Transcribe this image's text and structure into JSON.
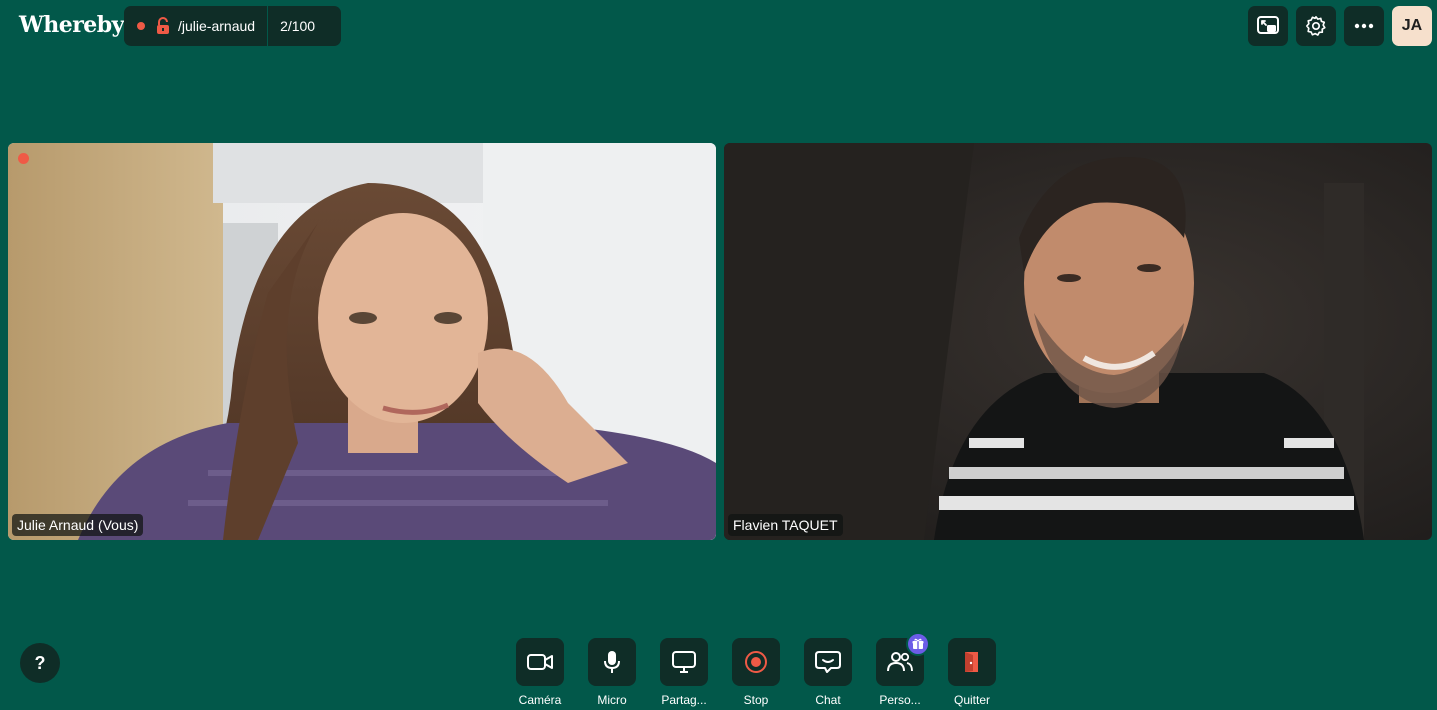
{
  "app": {
    "logo": "Whereby"
  },
  "room": {
    "name": "/julie-arnaud",
    "count": "2/100"
  },
  "header": {
    "avatar_initials": "JA",
    "icons": [
      "pip-icon",
      "gear-icon",
      "more-icon"
    ]
  },
  "participants": [
    {
      "name": "Julie Arnaud (Vous)",
      "recording": true
    },
    {
      "name": "Flavien TAQUET"
    }
  ],
  "controls": [
    {
      "label": "Caméra",
      "icon": "camera-icon"
    },
    {
      "label": "Micro",
      "icon": "microphone-icon"
    },
    {
      "label": "Partag...",
      "icon": "screen-share-icon"
    },
    {
      "label": "Stop",
      "icon": "record-stop-icon"
    },
    {
      "label": "Chat",
      "icon": "chat-icon"
    },
    {
      "label": "Perso...",
      "icon": "people-icon"
    },
    {
      "label": "Quitter",
      "icon": "leave-icon"
    }
  ],
  "help": {
    "label": "?"
  },
  "colors": {
    "background": "#02584a",
    "button": "#0f2d27",
    "record": "#ef5a46",
    "avatar": "#f6e0cc",
    "badge": "#6c5ce7"
  }
}
